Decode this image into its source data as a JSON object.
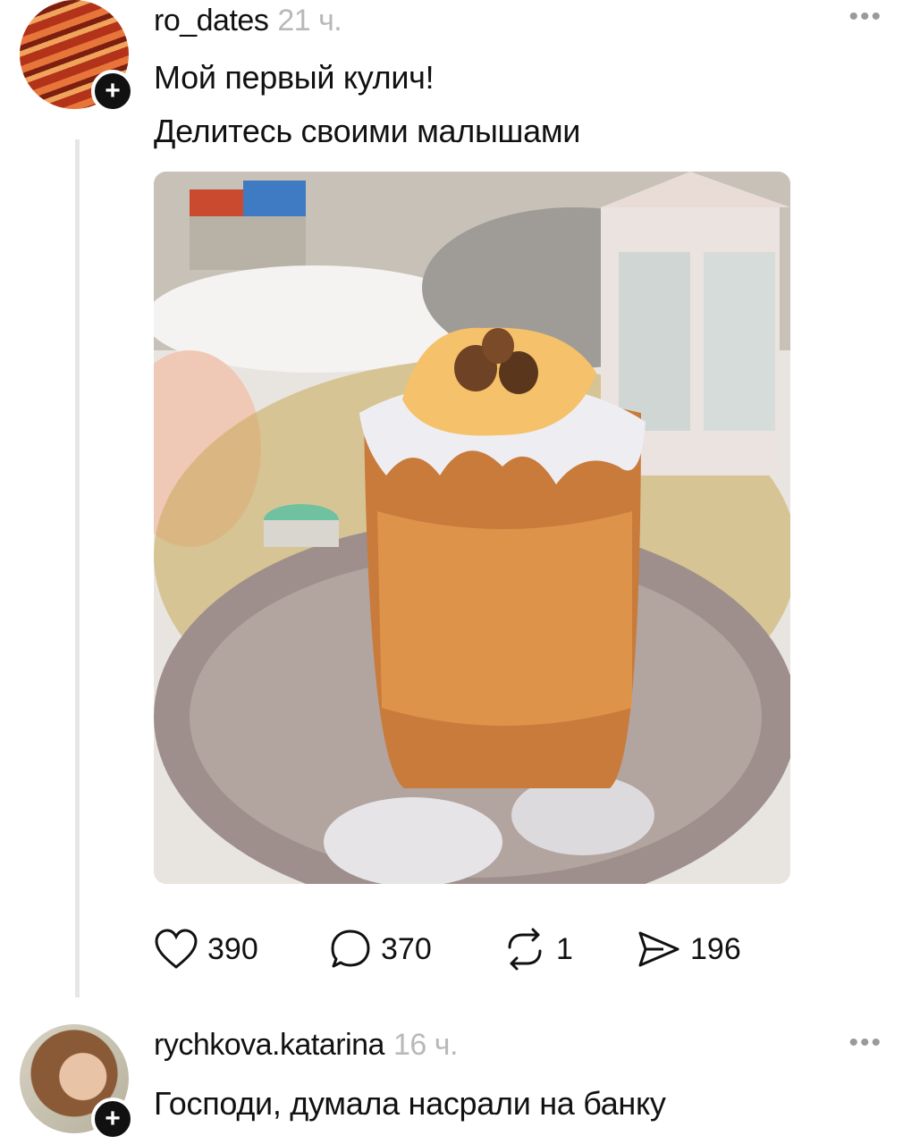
{
  "posts": [
    {
      "username": "ro_dates",
      "time": "21 ч.",
      "lines": [
        "Мой первый кулич!",
        "Делитесь своими малышами"
      ],
      "stats": {
        "likes": "390",
        "comments": "370",
        "reposts": "1",
        "shares": "196"
      }
    },
    {
      "username": "rychkova.katarina",
      "time": "16 ч.",
      "lines": [
        "Господи, думала насрали на банку"
      ]
    }
  ],
  "more_label": "•••",
  "icons": [
    "plus-icon",
    "heart-icon",
    "comment-icon",
    "repost-icon",
    "share-icon",
    "more-icon"
  ]
}
